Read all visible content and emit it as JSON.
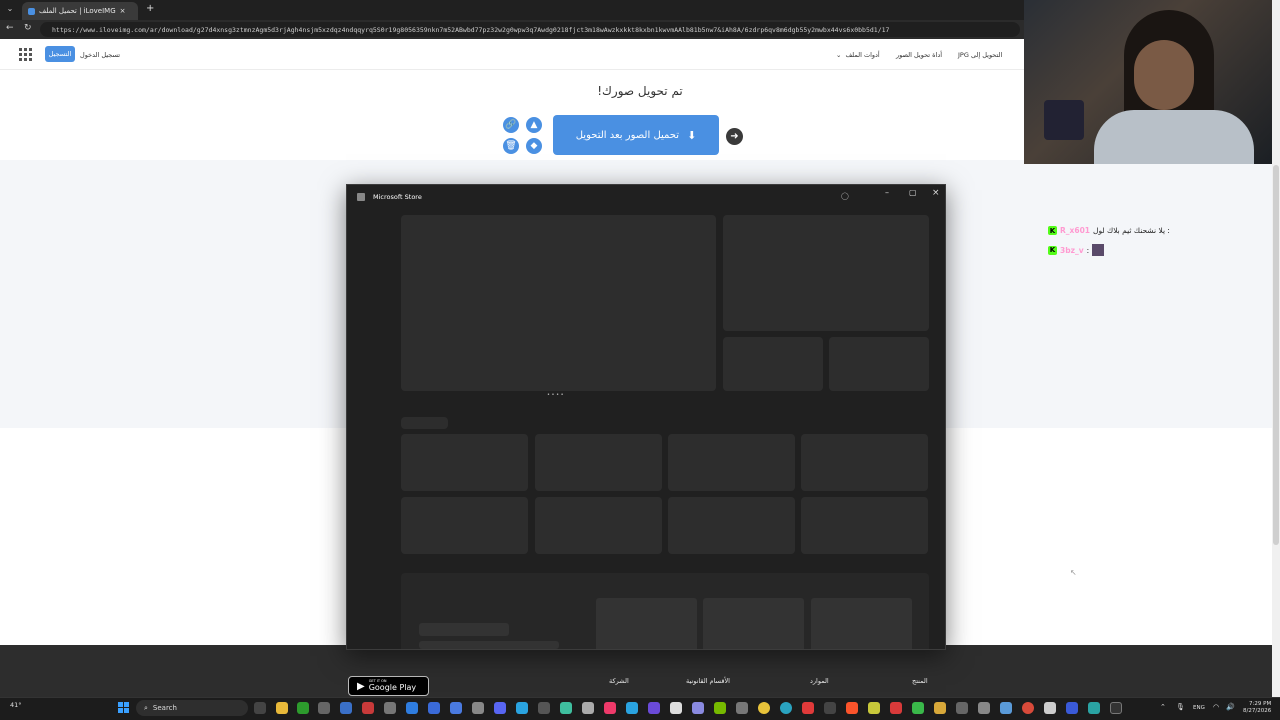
{
  "browser": {
    "tab_title": "iLoveIMG | تحميل الملف",
    "tab_close": "×",
    "new_tab": "+",
    "url": "https://www.iloveimg.com/ar/download/g27d4xnsg3ztmnzAgm5d3rjAgh4nsjm5xzdqz4ndqqyrq5S0r19g8056359nkn7m52ABwbd77pz32w2g0wpw3q7Awdg0218fjct3m18wAwzkxkkt8kxbn1kwvmAAlb81b5nw7&iAh8A/6zdrp6qv8m6dgb55y2mwbx44vs6x0bb5d1/17"
  },
  "header": {
    "signup": "التسجيل",
    "login": "تسجيل الدخول",
    "features": "أدوات الملف",
    "desktop": "أداة تحويل الصور",
    "convert_to": "التحويل إلى JPG"
  },
  "main": {
    "title": "تم تحويل صورك!",
    "download_label": "تحميل الصور بعد التحويل"
  },
  "footer": {
    "col1": "المنتج",
    "col2": "الموارد",
    "col3": "الأقسام القانونية",
    "col4": "الشركة",
    "gplay_small": "GET IT ON",
    "gplay_big": "Google Play"
  },
  "chat": [
    {
      "user": "R_x601",
      "message": ": يلا نشحنك ثيم بلاك لول",
      "color": "#ff9ad1"
    },
    {
      "user": "3bz_v",
      "message": ":",
      "color": "#ff9ad1"
    }
  ],
  "store": {
    "title": "Microsoft Store",
    "loading": "• • • •"
  },
  "taskbar": {
    "weather": "41°",
    "search": "Search",
    "lang": "ENG",
    "time": "7:29 PM",
    "date": "8/27/2026"
  }
}
